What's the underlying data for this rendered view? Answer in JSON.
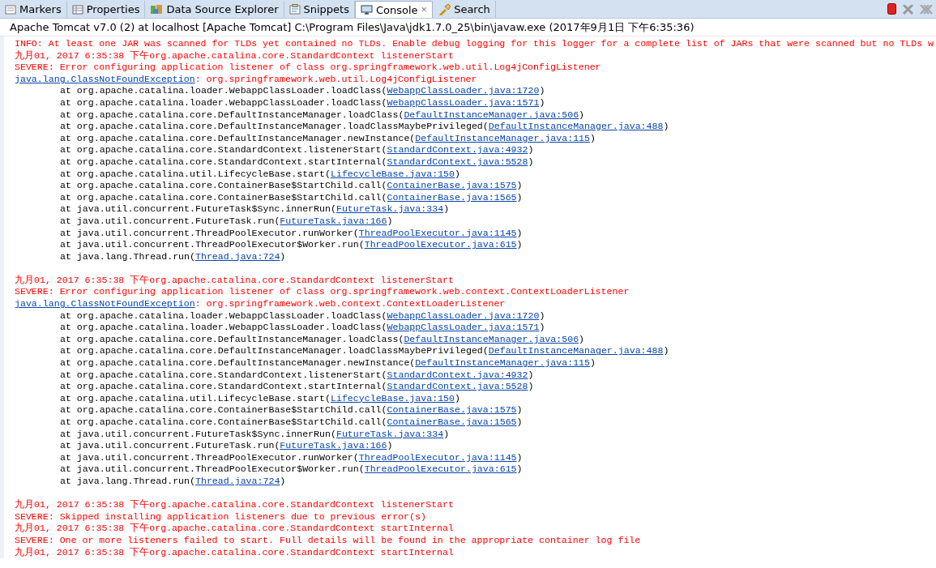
{
  "tabs": [
    {
      "label": "Markers",
      "selected": false
    },
    {
      "label": "Properties",
      "selected": false
    },
    {
      "label": "Data Source Explorer",
      "selected": false
    },
    {
      "label": "Snippets",
      "selected": false
    },
    {
      "label": "Console",
      "selected": true,
      "close": "✕"
    },
    {
      "label": "Search",
      "selected": false
    }
  ],
  "console_title": "Apache Tomcat v7.0 (2) at localhost [Apache Tomcat] C:\\Program Files\\Java\\jdk1.7.0_25\\bin\\javaw.exe (2017年9月1日 下午6:35:36)",
  "lines": [
    {
      "kind": "text",
      "text": "INFO: At least one JAR was scanned for TLDs yet contained no TLDs. Enable debug logging for this logger for a complete list of JARs that were scanned but no TLDs w"
    },
    {
      "kind": "text",
      "text": "九月01, 2017 6:35:38 下午org.apache.catalina.core.StandardContext listenerStart"
    },
    {
      "kind": "text",
      "text": "SEVERE: Error configuring application listener of class org.springframework.web.util.Log4jConfigListener"
    },
    {
      "kind": "exception",
      "link": "java.lang.ClassNotFoundException",
      "text": ": org.springframework.web.util.Log4jConfigListener"
    },
    {
      "kind": "frame",
      "text": "at org.apache.catalina.loader.WebappClassLoader.loadClass(",
      "link": "WebappClassLoader.java:1720",
      "suffix": ")"
    },
    {
      "kind": "frame",
      "text": "at org.apache.catalina.loader.WebappClassLoader.loadClass(",
      "link": "WebappClassLoader.java:1571",
      "suffix": ")"
    },
    {
      "kind": "frame",
      "text": "at org.apache.catalina.core.DefaultInstanceManager.loadClass(",
      "link": "DefaultInstanceManager.java:506",
      "suffix": ")"
    },
    {
      "kind": "frame",
      "text": "at org.apache.catalina.core.DefaultInstanceManager.loadClassMaybePrivileged(",
      "link": "DefaultInstanceManager.java:488",
      "suffix": ")"
    },
    {
      "kind": "frame",
      "text": "at org.apache.catalina.core.DefaultInstanceManager.newInstance(",
      "link": "DefaultInstanceManager.java:115",
      "suffix": ")"
    },
    {
      "kind": "frame",
      "text": "at org.apache.catalina.core.StandardContext.listenerStart(",
      "link": "StandardContext.java:4932",
      "suffix": ")"
    },
    {
      "kind": "frame",
      "text": "at org.apache.catalina.core.StandardContext.startInternal(",
      "link": "StandardContext.java:5528",
      "suffix": ")"
    },
    {
      "kind": "frame",
      "text": "at org.apache.catalina.util.LifecycleBase.start(",
      "link": "LifecycleBase.java:150",
      "suffix": ")"
    },
    {
      "kind": "frame",
      "text": "at org.apache.catalina.core.ContainerBase$StartChild.call(",
      "link": "ContainerBase.java:1575",
      "suffix": ")"
    },
    {
      "kind": "frame",
      "text": "at org.apache.catalina.core.ContainerBase$StartChild.call(",
      "link": "ContainerBase.java:1565",
      "suffix": ")"
    },
    {
      "kind": "frame",
      "text": "at java.util.concurrent.FutureTask$Sync.innerRun(",
      "link": "FutureTask.java:334",
      "suffix": ")"
    },
    {
      "kind": "frame",
      "text": "at java.util.concurrent.FutureTask.run(",
      "link": "FutureTask.java:166",
      "suffix": ")"
    },
    {
      "kind": "frame",
      "text": "at java.util.concurrent.ThreadPoolExecutor.runWorker(",
      "link": "ThreadPoolExecutor.java:1145",
      "suffix": ")"
    },
    {
      "kind": "frame",
      "text": "at java.util.concurrent.ThreadPoolExecutor$Worker.run(",
      "link": "ThreadPoolExecutor.java:615",
      "suffix": ")"
    },
    {
      "kind": "frame",
      "text": "at java.lang.Thread.run(",
      "link": "Thread.java:724",
      "suffix": ")"
    },
    {
      "kind": "blank"
    },
    {
      "kind": "text",
      "text": "九月01, 2017 6:35:38 下午org.apache.catalina.core.StandardContext listenerStart"
    },
    {
      "kind": "text",
      "text": "SEVERE: Error configuring application listener of class org.springframework.web.context.ContextLoaderListener"
    },
    {
      "kind": "exception",
      "link": "java.lang.ClassNotFoundException",
      "text": ": org.springframework.web.context.ContextLoaderListener"
    },
    {
      "kind": "frame",
      "text": "at org.apache.catalina.loader.WebappClassLoader.loadClass(",
      "link": "WebappClassLoader.java:1720",
      "suffix": ")"
    },
    {
      "kind": "frame",
      "text": "at org.apache.catalina.loader.WebappClassLoader.loadClass(",
      "link": "WebappClassLoader.java:1571",
      "suffix": ")"
    },
    {
      "kind": "frame",
      "text": "at org.apache.catalina.core.DefaultInstanceManager.loadClass(",
      "link": "DefaultInstanceManager.java:506",
      "suffix": ")"
    },
    {
      "kind": "frame",
      "text": "at org.apache.catalina.core.DefaultInstanceManager.loadClassMaybePrivileged(",
      "link": "DefaultInstanceManager.java:488",
      "suffix": ")"
    },
    {
      "kind": "frame",
      "text": "at org.apache.catalina.core.DefaultInstanceManager.newInstance(",
      "link": "DefaultInstanceManager.java:115",
      "suffix": ")"
    },
    {
      "kind": "frame",
      "text": "at org.apache.catalina.core.StandardContext.listenerStart(",
      "link": "StandardContext.java:4932",
      "suffix": ")"
    },
    {
      "kind": "frame",
      "text": "at org.apache.catalina.core.StandardContext.startInternal(",
      "link": "StandardContext.java:5528",
      "suffix": ")"
    },
    {
      "kind": "frame",
      "text": "at org.apache.catalina.util.LifecycleBase.start(",
      "link": "LifecycleBase.java:150",
      "suffix": ")"
    },
    {
      "kind": "frame",
      "text": "at org.apache.catalina.core.ContainerBase$StartChild.call(",
      "link": "ContainerBase.java:1575",
      "suffix": ")"
    },
    {
      "kind": "frame",
      "text": "at org.apache.catalina.core.ContainerBase$StartChild.call(",
      "link": "ContainerBase.java:1565",
      "suffix": ")"
    },
    {
      "kind": "frame",
      "text": "at java.util.concurrent.FutureTask$Sync.innerRun(",
      "link": "FutureTask.java:334",
      "suffix": ")"
    },
    {
      "kind": "frame",
      "text": "at java.util.concurrent.FutureTask.run(",
      "link": "FutureTask.java:166",
      "suffix": ")"
    },
    {
      "kind": "frame",
      "text": "at java.util.concurrent.ThreadPoolExecutor.runWorker(",
      "link": "ThreadPoolExecutor.java:1145",
      "suffix": ")"
    },
    {
      "kind": "frame",
      "text": "at java.util.concurrent.ThreadPoolExecutor$Worker.run(",
      "link": "ThreadPoolExecutor.java:615",
      "suffix": ")"
    },
    {
      "kind": "frame",
      "text": "at java.lang.Thread.run(",
      "link": "Thread.java:724",
      "suffix": ")"
    },
    {
      "kind": "blank"
    },
    {
      "kind": "text",
      "text": "九月01, 2017 6:35:38 下午org.apache.catalina.core.StandardContext listenerStart"
    },
    {
      "kind": "text",
      "text": "SEVERE: Skipped installing application listeners due to previous error(s)"
    },
    {
      "kind": "text",
      "text": "九月01, 2017 6:35:38 下午org.apache.catalina.core.StandardContext startInternal"
    },
    {
      "kind": "text",
      "text": "SEVERE: One or more listeners failed to start. Full details will be found in the appropriate container log file"
    },
    {
      "kind": "text",
      "text": "九月01, 2017 6:35:38 下午org.apache.catalina.core.StandardContext startInternal"
    }
  ]
}
